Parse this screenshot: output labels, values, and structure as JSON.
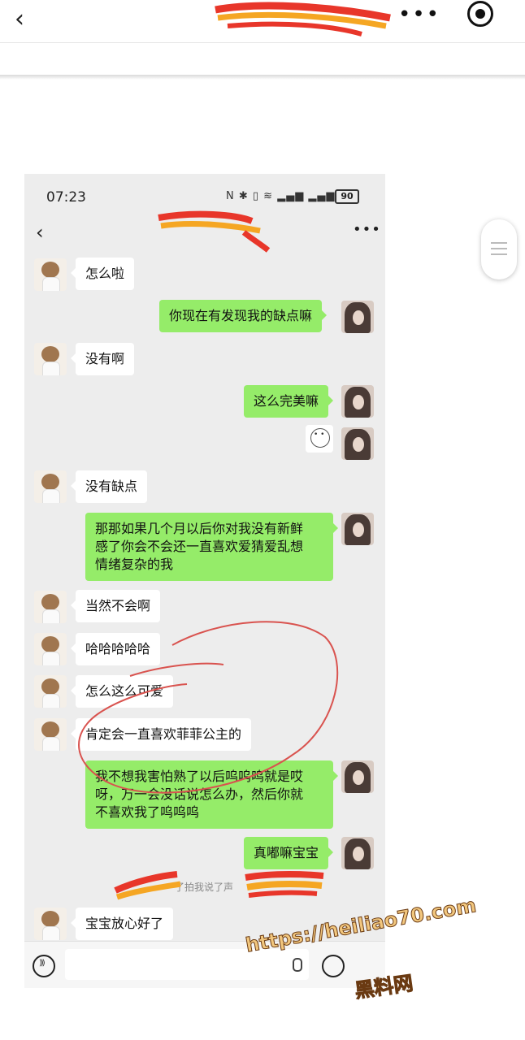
{
  "top_bar": {
    "back_icon": "chevron-left-icon",
    "more_icon": "more-dots-icon",
    "target_icon": "record-target-icon"
  },
  "side_handle": {
    "icon": "menu-lines-icon"
  },
  "phone_screenshot": {
    "status": {
      "time": "07:23",
      "battery": "90"
    },
    "chat_header": {
      "back_icon": "chevron-left-icon",
      "more_icon": "more-dots-icon"
    },
    "messages": [
      {
        "side": "left",
        "text": "怎么啦"
      },
      {
        "side": "right",
        "text": "你现在有发现我的缺点嘛"
      },
      {
        "side": "left",
        "text": "没有啊"
      },
      {
        "side": "right",
        "text": "这么完美嘛"
      },
      {
        "side": "right",
        "text": "",
        "emoji": "sticker-face-icon"
      },
      {
        "side": "left",
        "text": "没有缺点"
      },
      {
        "side": "right",
        "lines": [
          "那那如果几个月以后你对我没有新鲜",
          "感了你会不会还一直喜欢爱猜爱乱想",
          "情绪复杂的我"
        ]
      },
      {
        "side": "left",
        "text": "当然不会啊"
      },
      {
        "side": "left",
        "text": "哈哈哈哈哈"
      },
      {
        "side": "left",
        "text": "怎么这么可爱"
      },
      {
        "side": "left",
        "text": "肯定会一直喜欢菲菲公主的"
      },
      {
        "side": "right",
        "lines": [
          "我不想我害怕熟了以后呜呜呜就是哎",
          "呀，万一会没话说怎么办，然后你就",
          "不喜欢我了呜呜呜"
        ]
      },
      {
        "side": "right",
        "text": "真嘟嘛宝宝"
      },
      {
        "side": "left",
        "text": "宝宝放心好了"
      }
    ],
    "system_message": "了拍我说了声",
    "input_bar": {
      "voice_icon": "voice-icon",
      "mic_icon": "mic-icon",
      "emoji_icon": "emoji-icon"
    }
  },
  "watermark": {
    "url": "https://heiliao70.com",
    "name": "黑料网"
  },
  "colors": {
    "sent_bubble": "#95ec69",
    "received_bubble": "#ffffff",
    "chat_bg": "#ededed",
    "annotation": "#d9534f"
  }
}
